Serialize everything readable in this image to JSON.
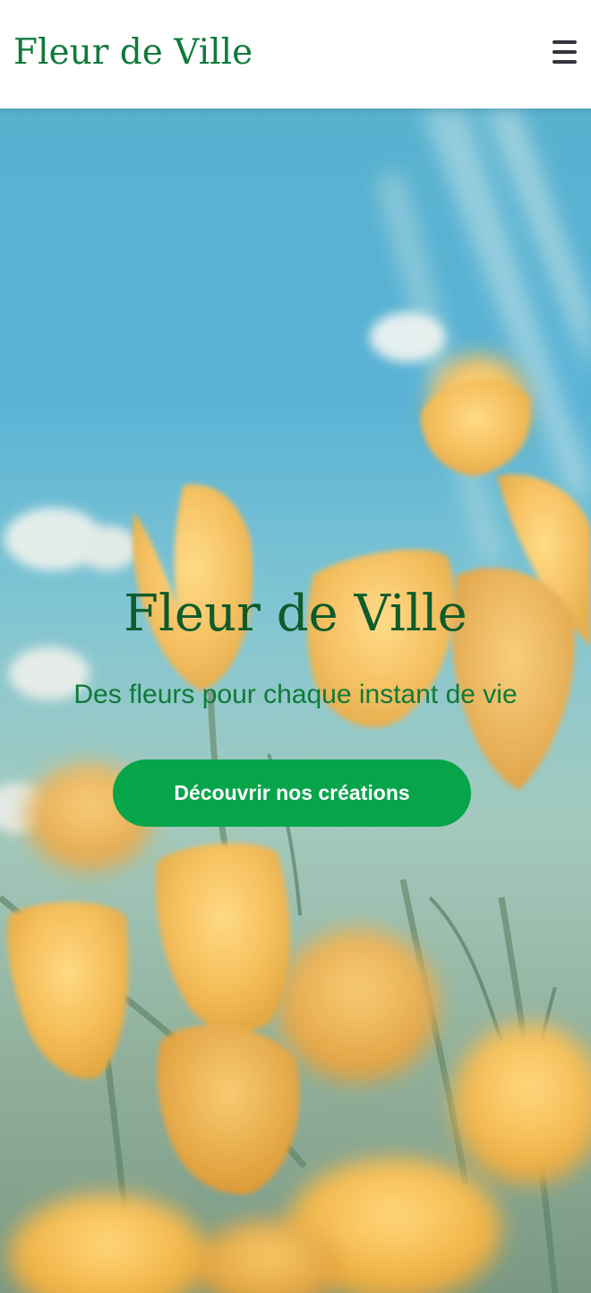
{
  "header": {
    "logo_text": "Fleur de Ville",
    "menu_icon": "hamburger-menu-icon"
  },
  "hero": {
    "background_image": "yellow-poppies-blue-sky-photo",
    "title": "Fleur de Ville",
    "subtitle": "Des fleurs pour chaque instant de vie",
    "cta_label": "Découvrir nos créations"
  },
  "colors": {
    "brand_green": "#0f7a3b",
    "title_green": "#0f5b2b",
    "button_green": "#06a54a",
    "menu_icon": "#30353b",
    "sky_blue": "#35a2cc",
    "poppy_yellow": "#f2b233"
  }
}
